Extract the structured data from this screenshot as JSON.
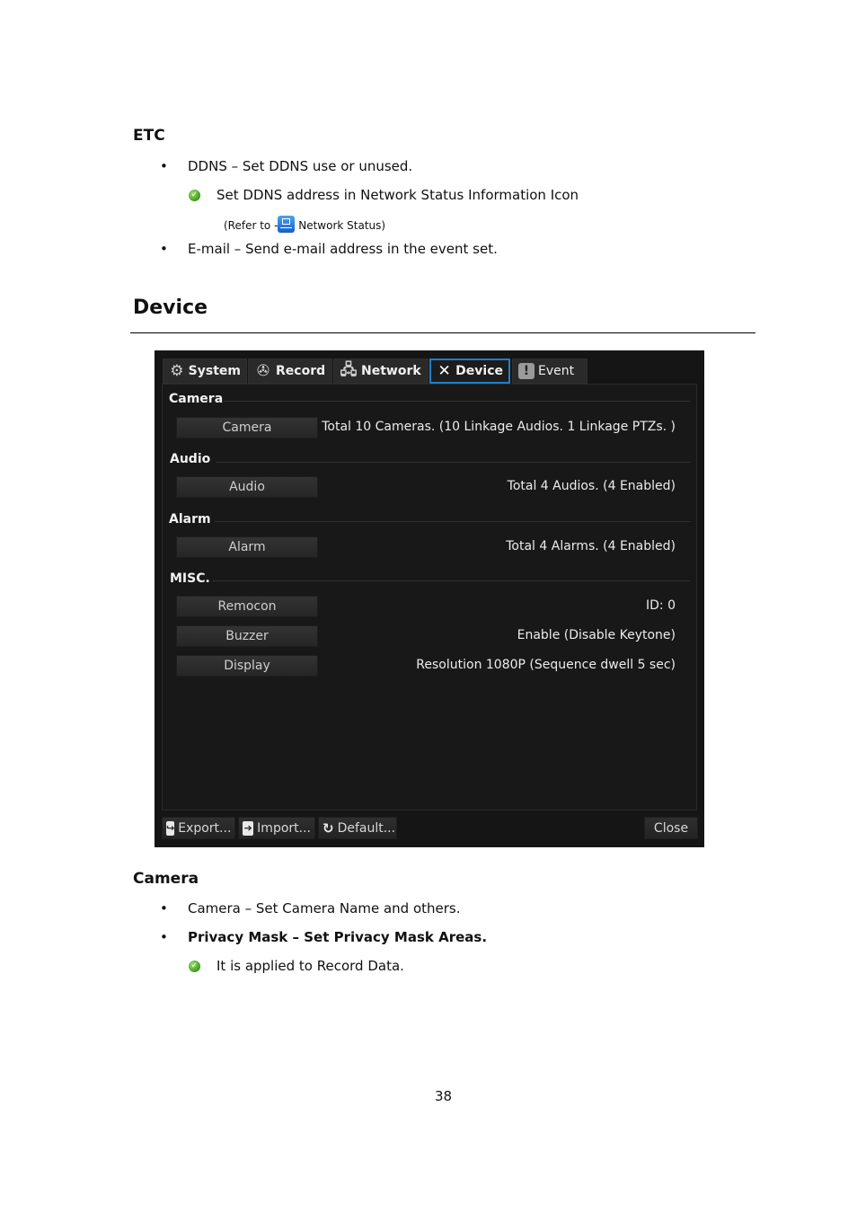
{
  "etc": {
    "heading": "ETC",
    "bullets": [
      "DDNS – Set DDNS use or unused.",
      "E-mail – Send e-mail address in the event set."
    ],
    "note": "Set DDNS address in Network Status Information Icon",
    "refer_prefix": "(Refer to   -",
    "refer_suffix": " Network Status)",
    "refer_icon": "network-status-icon"
  },
  "section": {
    "title": "Device"
  },
  "dialog": {
    "tabs": [
      {
        "label": "System",
        "icon": "gear-icon"
      },
      {
        "label": "Record",
        "icon": "film-reel-icon"
      },
      {
        "label": "Network",
        "icon": "network-icon"
      },
      {
        "label": "Device",
        "icon": "tools-icon",
        "active": true
      },
      {
        "label": "Event",
        "icon": "exclamation-icon"
      }
    ],
    "groups": {
      "camera": "Camera",
      "audio": "Audio",
      "alarm": "Alarm",
      "misc": "MISC."
    },
    "rows": [
      {
        "button": "Camera",
        "value": "Total 10 Cameras. (10 Linkage Audios. 1 Linkage PTZs. )"
      },
      {
        "button": "Audio",
        "value": "Total 4 Audios. (4 Enabled)"
      },
      {
        "button": "Alarm",
        "value": "Total 4 Alarms. (4 Enabled)"
      },
      {
        "button": "Remocon",
        "value": "ID: 0"
      },
      {
        "button": "Buzzer",
        "value": "Enable (Disable Keytone)"
      },
      {
        "button": "Display",
        "value": "Resolution 1080P (Sequence dwell 5 sec)"
      }
    ],
    "footer": {
      "export": "Export...",
      "import": "Import...",
      "default": "Default...",
      "close": "Close"
    },
    "colors": {
      "active_tab_border": "#1f7fc8",
      "background": "#151515"
    }
  },
  "camera_section": {
    "heading": "Camera",
    "bullets": [
      "Camera – Set Camera Name and others.",
      "Privacy Mask – Set Privacy Mask Areas."
    ],
    "note": "It is applied to Record Data."
  },
  "page_number": "38"
}
